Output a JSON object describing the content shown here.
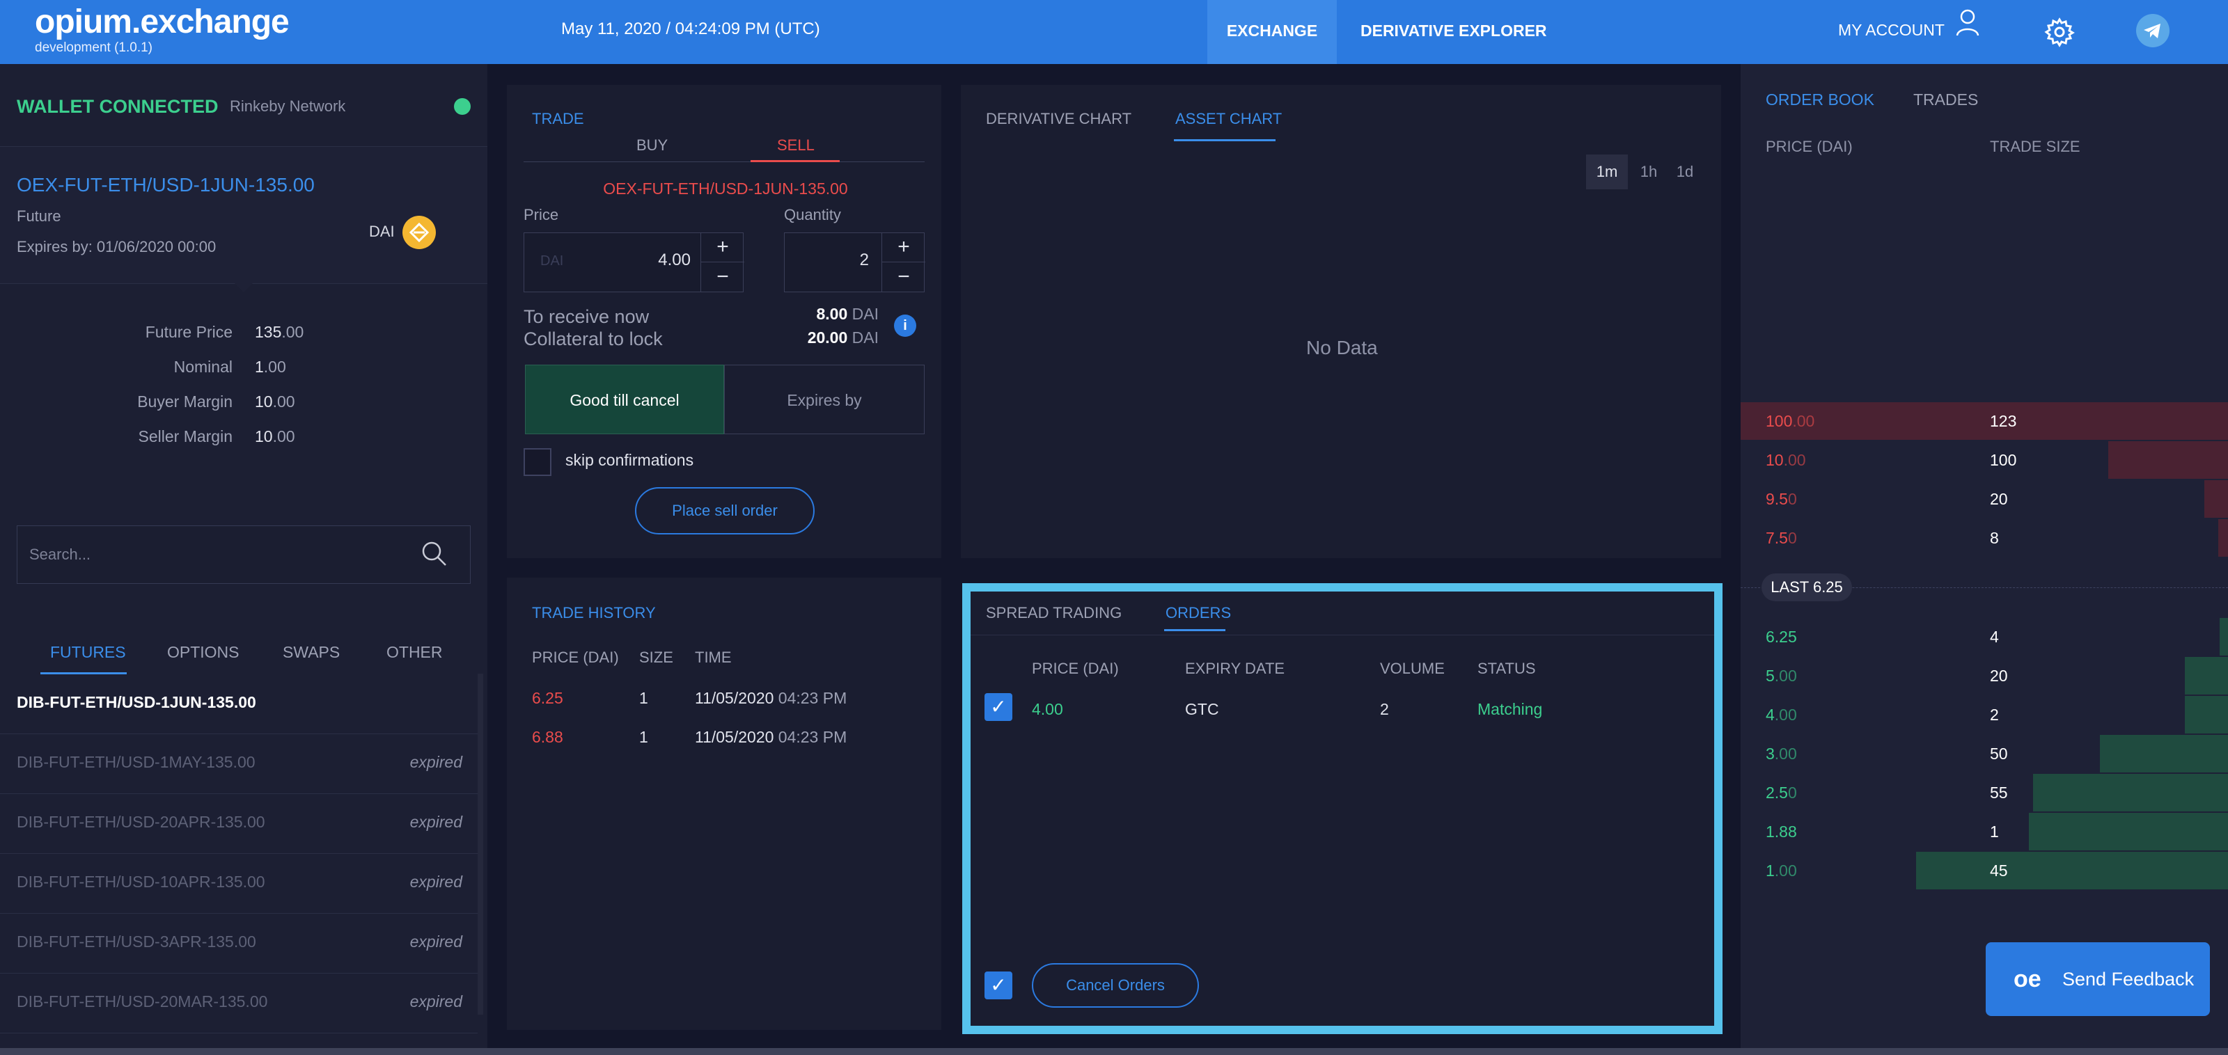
{
  "header": {
    "logo": "opium.exchange",
    "build": "development (1.0.1)",
    "datetime": "May 11, 2020 / 04:24:09 PM (UTC)",
    "nav": {
      "exchange": "EXCHANGE",
      "derivative_explorer": "DERIVATIVE EXPLORER",
      "account": "MY ACCOUNT"
    },
    "icons": {
      "account": "user-icon",
      "settings": "gear-icon",
      "telegram": "telegram-icon"
    },
    "colors": {
      "bar": "#2b7ae0"
    }
  },
  "wallet": {
    "status": "WALLET CONNECTED",
    "network": "Rinkeby Network",
    "status_color": "#3ccf8e"
  },
  "selected": {
    "name": "OEX-FUT-ETH/USD-1JUN-135.00",
    "type": "Future",
    "expires": "Expires by: 01/06/2020 00:00",
    "currency": "DAI",
    "details": [
      {
        "label": "Future Price",
        "value_main": "135",
        "value_dec": ".00"
      },
      {
        "label": "Nominal",
        "value_main": "1",
        "value_dec": ".00"
      },
      {
        "label": "Buyer Margin",
        "value_main": "10",
        "value_dec": ".00"
      },
      {
        "label": "Seller Margin",
        "value_main": "10",
        "value_dec": ".00"
      }
    ]
  },
  "search": {
    "placeholder": "Search..."
  },
  "categories": [
    "FUTURES",
    "OPTIONS",
    "SWAPS",
    "OTHER"
  ],
  "active_category": "FUTURES",
  "derivatives": [
    {
      "name": "DIB-FUT-ETH/USD-1JUN-135.00",
      "status": ""
    },
    {
      "name": "DIB-FUT-ETH/USD-1MAY-135.00",
      "status": "expired"
    },
    {
      "name": "DIB-FUT-ETH/USD-20APR-135.00",
      "status": "expired"
    },
    {
      "name": "DIB-FUT-ETH/USD-10APR-135.00",
      "status": "expired"
    },
    {
      "name": "DIB-FUT-ETH/USD-3APR-135.00",
      "status": "expired"
    },
    {
      "name": "DIB-FUT-ETH/USD-20MAR-135.00",
      "status": "expired"
    }
  ],
  "trade": {
    "title": "TRADE",
    "buy": "BUY",
    "sell": "SELL",
    "ticker": "OEX-FUT-ETH/USD-1JUN-135.00",
    "price_label": "Price",
    "quantity_label": "Quantity",
    "price_prefix": "DAI",
    "price_value": "4.00",
    "quantity_value": "2",
    "receive_label": "To receive now",
    "receive_value": "8.00",
    "collateral_label": "Collateral to lock",
    "collateral_value": "20.00",
    "unit": "DAI",
    "gtc": "Good till cancel",
    "expires_by": "Expires by",
    "skip": "skip confirmations",
    "place": "Place sell order"
  },
  "chart": {
    "tabs": [
      "DERIVATIVE CHART",
      "ASSET CHART"
    ],
    "active_tab": "ASSET CHART",
    "timeframes": [
      "1m",
      "1h",
      "1d"
    ],
    "active_timeframe": "1m",
    "empty": "No Data"
  },
  "history": {
    "title": "TRADE HISTORY",
    "columns": [
      "PRICE (DAI)",
      "SIZE",
      "TIME"
    ],
    "rows": [
      {
        "price": "6.25",
        "size": "1",
        "date": "11/05/2020",
        "time": "04:23 PM"
      },
      {
        "price": "6.88",
        "size": "1",
        "date": "11/05/2020",
        "time": "04:23 PM"
      }
    ]
  },
  "orders": {
    "tabs": [
      "SPREAD TRADING",
      "ORDERS"
    ],
    "active_tab": "ORDERS",
    "columns": [
      "PRICE (DAI)",
      "EXPIRY DATE",
      "VOLUME",
      "STATUS"
    ],
    "rows": [
      {
        "price": "4.00",
        "expiry": "GTC",
        "volume": "2",
        "status": "Matching",
        "checked": true
      }
    ],
    "cancel": "Cancel Orders"
  },
  "orderbook": {
    "tabs": [
      "ORDER BOOK",
      "TRADES"
    ],
    "active_tab": "ORDER BOOK",
    "columns": [
      "PRICE (DAI)",
      "TRADE SIZE"
    ],
    "asks": [
      {
        "int": "100",
        "dec": ".00",
        "size": "123",
        "fill": 1.0
      },
      {
        "int": "10",
        "dec": ".00",
        "size": "100",
        "fill": 0.246
      },
      {
        "int": "9.5",
        "dec": "0",
        "size": "20",
        "fill": 0.049
      },
      {
        "int": "7.5",
        "dec": "0",
        "size": "8",
        "fill": 0.02
      }
    ],
    "last": "LAST 6.25",
    "bids": [
      {
        "int": "6.25",
        "dec": "",
        "size": "4",
        "fill": 0.017
      },
      {
        "int": "5",
        "dec": ".00",
        "size": "20",
        "fill": 0.089
      },
      {
        "int": "4",
        "dec": ".00",
        "size": "2",
        "fill": 0.089
      },
      {
        "int": "3",
        "dec": ".00",
        "size": "50",
        "fill": 0.263
      },
      {
        "int": "2.5",
        "dec": "0",
        "size": "55",
        "fill": 0.4
      },
      {
        "int": "1.88",
        "dec": "",
        "size": "1",
        "fill": 0.409
      },
      {
        "int": "1",
        "dec": ".00",
        "size": "45",
        "fill": 0.64
      }
    ],
    "colors": {
      "ask": "#ea4c4c",
      "bid": "#3ccf8e"
    }
  },
  "feedback": {
    "label": "Send Feedback",
    "logo": "oe"
  }
}
